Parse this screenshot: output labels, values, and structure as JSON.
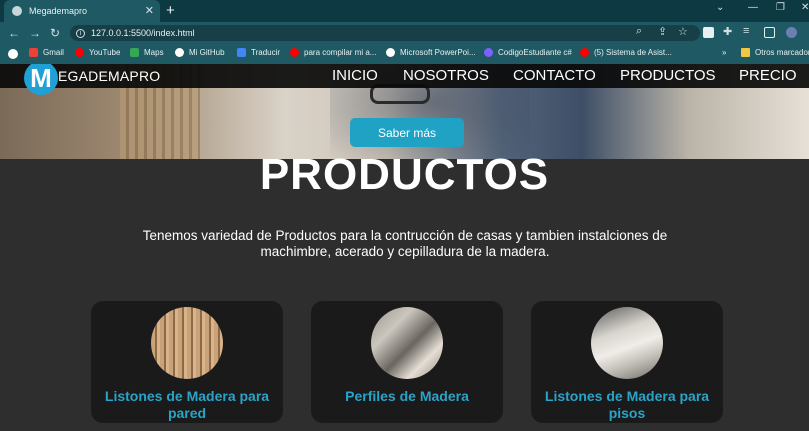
{
  "browser": {
    "tab_title": "Megademapro",
    "new_tab_label": "+",
    "url": "127.0.0.1:5500/index.html",
    "bookmarks": [
      {
        "label": "Gmail",
        "icon": "gmail-icon",
        "color": "#ea4335"
      },
      {
        "label": "YouTube",
        "icon": "youtube-icon",
        "color": "#ff0000"
      },
      {
        "label": "Maps",
        "icon": "maps-icon",
        "color": "#34a853"
      },
      {
        "label": "Mi GitHub",
        "icon": "github-icon",
        "color": "#ffffff"
      },
      {
        "label": "Traducir",
        "icon": "translate-icon",
        "color": "#4285f4"
      },
      {
        "label": "para compilar mi a...",
        "icon": "youtube-icon",
        "color": "#ff0000"
      },
      {
        "label": "Microsoft PowerPoi...",
        "icon": "powerpoint-icon",
        "color": "#ffffff"
      },
      {
        "label": "CodigoEstudiante c#",
        "icon": "codigo-icon",
        "color": "#7b61ff"
      },
      {
        "label": "(5) Sistema de Asist...",
        "icon": "youtube-icon",
        "color": "#ff0000"
      },
      {
        "label": "Otros marcadores",
        "icon": "folder-icon",
        "color": "#f2c744"
      }
    ],
    "overflow_label": "»"
  },
  "site": {
    "logo_letter": "M",
    "brand": "EGADEMAPRO",
    "nav": [
      "INICIO",
      "NOSOTROS",
      "CONTACTO",
      "PRODUCTOS",
      "PRECIO"
    ],
    "cta": "Saber más"
  },
  "products": {
    "title": "PRODUCTOS",
    "description": "Tenemos variedad de Productos para la contrucción de casas y tambien instalciones de machimbre, acerado y cepilladura de la madera.",
    "cards": [
      {
        "title": "Listones de Madera para pared"
      },
      {
        "title": "Perfiles de Madera"
      },
      {
        "title": "Listones de Madera para pisos"
      }
    ]
  },
  "colors": {
    "accent": "#20a2c4",
    "card_title": "#2aa3c9",
    "page_bg": "#2e2e2e",
    "card_bg": "#1a1a1a",
    "chrome": "#1f5963"
  }
}
